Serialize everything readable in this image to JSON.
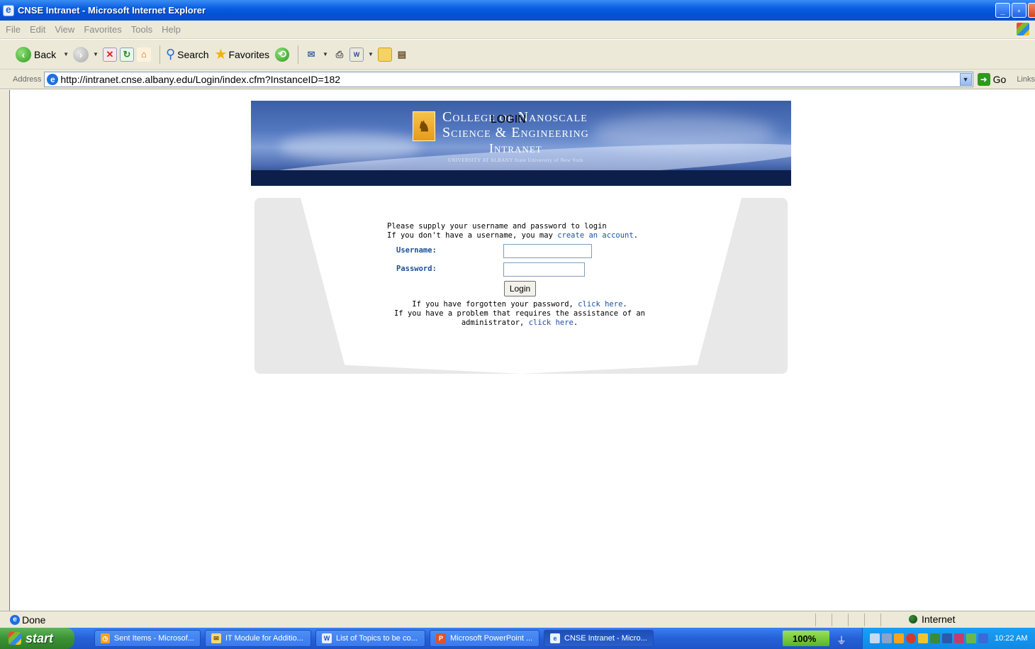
{
  "window": {
    "title": "CNSE Intranet - Microsoft Internet Explorer"
  },
  "menu": [
    "File",
    "Edit",
    "View",
    "Favorites",
    "Tools",
    "Help"
  ],
  "toolbar": {
    "back": "Back",
    "search": "Search",
    "favorites": "Favorites"
  },
  "address": {
    "label": "Address",
    "url": "http://intranet.cnse.albany.edu/Login/index.cfm?InstanceID=182",
    "go": "Go",
    "links": "Links"
  },
  "banner": {
    "line1": "College of Nanoscale",
    "line2": "Science & Engineering",
    "line3": "Intranet",
    "line4": "UNIVERSITY AT ALBANY State University of New York"
  },
  "login": {
    "title": "LOGIN",
    "intro1": "Please supply your username and password to login",
    "intro2_prefix": "If you don't have a username, you may ",
    "intro2_link": "create an account",
    "intro2_suffix": ".",
    "username_label": "Username:",
    "password_label": "Password:",
    "button": "Login",
    "forgot_prefix": "If you have forgotten your password, ",
    "forgot_link": "click here",
    "forgot_suffix": ".",
    "admin_line1": "If you have a problem that requires the assistance of an",
    "admin_prefix": "administrator, ",
    "admin_link": "click here",
    "admin_suffix": "."
  },
  "status": {
    "text": "Done",
    "zone": "Internet"
  },
  "taskbar": {
    "start": "start",
    "tasks": [
      "Sent Items - Microsof...",
      "IT Module for Additio...",
      "List of Topics to be co...",
      "Microsoft PowerPoint ...",
      "CNSE Intranet - Micro..."
    ],
    "zoom": "100%",
    "clock": "10:22 AM"
  }
}
